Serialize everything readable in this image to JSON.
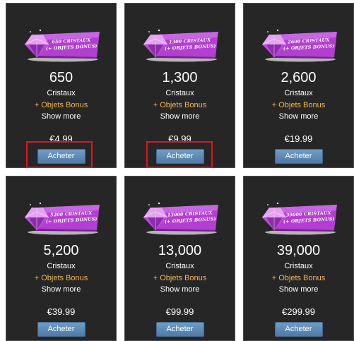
{
  "colors": {
    "card_bg": "#262626",
    "bonus_text": "#f2b84b",
    "button_bg": "#5a89b4",
    "highlight": "#e0141c",
    "gem": "#a340c8"
  },
  "packages": [
    {
      "banner_line1": "650 CRISTAUX",
      "banner_line2": "(+ OBJETS BONUS)",
      "amount": "650",
      "unit": "Cristaux",
      "bonus": "+ Objets Bonus",
      "more": "Show more",
      "price": "€4.99",
      "button": "Acheter",
      "highlighted": true
    },
    {
      "banner_line1": "1300 CRISTAUX",
      "banner_line2": "(+ OBJETS BONUS)",
      "amount": "1,300",
      "unit": "Cristaux",
      "bonus": "+ Objets Bonus",
      "more": "Show more",
      "price": "€9.99",
      "button": "Acheter",
      "highlighted": true
    },
    {
      "banner_line1": "2600 CRISTAUX",
      "banner_line2": "(+ OBJETS BONUS)",
      "amount": "2,600",
      "unit": "Cristaux",
      "bonus": "+ Objets Bonus",
      "more": "Show more",
      "price": "€19.99",
      "button": "Acheter",
      "highlighted": false
    },
    {
      "banner_line1": "5200 CRISTAUX",
      "banner_line2": "(+ OBJETS BONUS)",
      "amount": "5,200",
      "unit": "Cristaux",
      "bonus": "+ Objets Bonus",
      "more": "Show more",
      "price": "€39.99",
      "button": "Acheter",
      "highlighted": false
    },
    {
      "banner_line1": "13000 CRISTAUX",
      "banner_line2": "(+ OBJETS BONUS)",
      "amount": "13,000",
      "unit": "Cristaux",
      "bonus": "+ Objets Bonus",
      "more": "Show more",
      "price": "€99.99",
      "button": "Acheter",
      "highlighted": false
    },
    {
      "banner_line1": "39000 CRISTAUX",
      "banner_line2": "(+ OBJETS BONUS)",
      "amount": "39,000",
      "unit": "Cristaux",
      "bonus": "+ Objets Bonus",
      "more": "Show more",
      "price": "€299.99",
      "button": "Acheter",
      "highlighted": false
    }
  ]
}
